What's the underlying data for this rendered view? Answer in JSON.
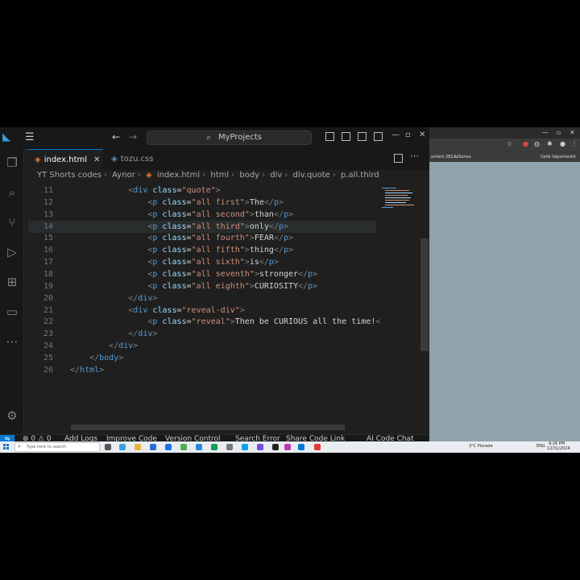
{
  "window": {
    "command_center": "MyProjects"
  },
  "tabs": [
    {
      "label": "index.html",
      "active": true
    },
    {
      "label": "tozu.css",
      "active": false
    }
  ],
  "breadcrumbs": [
    "YT Shorts codes",
    "Aynor",
    "index.html",
    "html",
    "body",
    "div",
    "div.quote",
    "p.all.third"
  ],
  "editor": {
    "lines": [
      {
        "n": "11",
        "indent": 6,
        "tokens": [
          [
            "tg",
            "<"
          ],
          [
            "tn",
            "div"
          ],
          [
            "tx",
            " "
          ],
          [
            "at",
            "class"
          ],
          [
            "tx",
            "="
          ],
          [
            "sv",
            "\"quote\""
          ],
          [
            "tg",
            ">"
          ]
        ]
      },
      {
        "n": "12",
        "indent": 8,
        "tokens": [
          [
            "tg",
            "<"
          ],
          [
            "tn",
            "p"
          ],
          [
            "tx",
            " "
          ],
          [
            "at",
            "class"
          ],
          [
            "tx",
            "="
          ],
          [
            "sv",
            "\"all first\""
          ],
          [
            "tg",
            ">"
          ],
          [
            "tx",
            "The"
          ],
          [
            "tg",
            "</"
          ],
          [
            "tn",
            "p"
          ],
          [
            "tg",
            ">"
          ]
        ]
      },
      {
        "n": "13",
        "indent": 8,
        "tokens": [
          [
            "tg",
            "<"
          ],
          [
            "tn",
            "p"
          ],
          [
            "tx",
            " "
          ],
          [
            "at",
            "class"
          ],
          [
            "tx",
            "="
          ],
          [
            "sv",
            "\"all second\""
          ],
          [
            "tg",
            ">"
          ],
          [
            "tx",
            "than"
          ],
          [
            "tg",
            "</"
          ],
          [
            "tn",
            "p"
          ],
          [
            "tg",
            ">"
          ]
        ]
      },
      {
        "n": "14",
        "indent": 8,
        "tokens": [
          [
            "tg",
            "<"
          ],
          [
            "tn",
            "p"
          ],
          [
            "tx",
            " "
          ],
          [
            "at",
            "class"
          ],
          [
            "tx",
            "="
          ],
          [
            "sv",
            "\"all third\""
          ],
          [
            "tg",
            ">"
          ],
          [
            "tx",
            "only"
          ],
          [
            "tg",
            "</"
          ],
          [
            "tn",
            "p"
          ],
          [
            "tg",
            ">"
          ]
        ],
        "highlight": true
      },
      {
        "n": "15",
        "indent": 8,
        "tokens": [
          [
            "tg",
            "<"
          ],
          [
            "tn",
            "p"
          ],
          [
            "tx",
            " "
          ],
          [
            "at",
            "class"
          ],
          [
            "tx",
            "="
          ],
          [
            "sv",
            "\"all fourth\""
          ],
          [
            "tg",
            ">"
          ],
          [
            "tx",
            "FEAR"
          ],
          [
            "tg",
            "</"
          ],
          [
            "tn",
            "p"
          ],
          [
            "tg",
            ">"
          ]
        ]
      },
      {
        "n": "16",
        "indent": 8,
        "tokens": [
          [
            "tg",
            "<"
          ],
          [
            "tn",
            "p"
          ],
          [
            "tx",
            " "
          ],
          [
            "at",
            "class"
          ],
          [
            "tx",
            "="
          ],
          [
            "sv",
            "\"all fifth\""
          ],
          [
            "tg",
            ">"
          ],
          [
            "tx",
            "thing"
          ],
          [
            "tg",
            "</"
          ],
          [
            "tn",
            "p"
          ],
          [
            "tg",
            ">"
          ]
        ]
      },
      {
        "n": "17",
        "indent": 8,
        "tokens": [
          [
            "tg",
            "<"
          ],
          [
            "tn",
            "p"
          ],
          [
            "tx",
            " "
          ],
          [
            "at",
            "class"
          ],
          [
            "tx",
            "="
          ],
          [
            "sv",
            "\"all sixth\""
          ],
          [
            "tg",
            ">"
          ],
          [
            "tx",
            "is"
          ],
          [
            "tg",
            "</"
          ],
          [
            "tn",
            "p"
          ],
          [
            "tg",
            ">"
          ]
        ]
      },
      {
        "n": "18",
        "indent": 8,
        "tokens": [
          [
            "tg",
            "<"
          ],
          [
            "tn",
            "p"
          ],
          [
            "tx",
            " "
          ],
          [
            "at",
            "class"
          ],
          [
            "tx",
            "="
          ],
          [
            "sv",
            "\"all seventh\""
          ],
          [
            "tg",
            ">"
          ],
          [
            "tx",
            "stronger"
          ],
          [
            "tg",
            "</"
          ],
          [
            "tn",
            "p"
          ],
          [
            "tg",
            ">"
          ]
        ]
      },
      {
        "n": "19",
        "indent": 8,
        "tokens": [
          [
            "tg",
            "<"
          ],
          [
            "tn",
            "p"
          ],
          [
            "tx",
            " "
          ],
          [
            "at",
            "class"
          ],
          [
            "tx",
            "="
          ],
          [
            "sv",
            "\"all eighth\""
          ],
          [
            "tg",
            ">"
          ],
          [
            "tx",
            "CURIOSITY"
          ],
          [
            "tg",
            "</"
          ],
          [
            "tn",
            "p"
          ],
          [
            "tg",
            ">"
          ]
        ]
      },
      {
        "n": "20",
        "indent": 6,
        "tokens": [
          [
            "tg",
            "</"
          ],
          [
            "tn",
            "div"
          ],
          [
            "tg",
            ">"
          ]
        ]
      },
      {
        "n": "21",
        "indent": 6,
        "tokens": [
          [
            "tg",
            "<"
          ],
          [
            "tn",
            "div"
          ],
          [
            "tx",
            " "
          ],
          [
            "at",
            "class"
          ],
          [
            "tx",
            "="
          ],
          [
            "sv",
            "\"reveal-div\""
          ],
          [
            "tg",
            ">"
          ]
        ]
      },
      {
        "n": "22",
        "indent": 8,
        "tokens": [
          [
            "tg",
            "<"
          ],
          [
            "tn",
            "p"
          ],
          [
            "tx",
            " "
          ],
          [
            "at",
            "class"
          ],
          [
            "tx",
            "="
          ],
          [
            "sv",
            "\"reveal\""
          ],
          [
            "tg",
            ">"
          ],
          [
            "tx",
            "Then be CURIOUS all the time!"
          ],
          [
            "tg",
            "<"
          ]
        ]
      },
      {
        "n": "23",
        "indent": 6,
        "tokens": [
          [
            "tg",
            "</"
          ],
          [
            "tn",
            "div"
          ],
          [
            "tg",
            ">"
          ]
        ]
      },
      {
        "n": "24",
        "indent": 4,
        "tokens": [
          [
            "tg",
            "</"
          ],
          [
            "tn",
            "div"
          ],
          [
            "tg",
            ">"
          ]
        ]
      },
      {
        "n": "25",
        "indent": 2,
        "tokens": [
          [
            "tg",
            "</"
          ],
          [
            "tn",
            "body"
          ],
          [
            "tg",
            ">"
          ]
        ]
      },
      {
        "n": "26",
        "indent": 0,
        "tokens": [
          [
            "tg",
            "</"
          ],
          [
            "tn",
            "html"
          ],
          [
            "tg",
            ">"
          ]
        ]
      }
    ]
  },
  "status_bar": {
    "problems": "⊗ 0 ⚠ 0",
    "items": [
      "Add Logs",
      "Improve Code",
      "Version Control",
      "Search Error",
      "Share Code Link",
      "AI Code Chat"
    ]
  },
  "browser": {
    "bookmarks": [
      "ontent 282...",
      "AdSense",
      "Gelik İdipsimerkit"
    ]
  },
  "taskbar": {
    "search_placeholder": "Type here to search",
    "weather": "3°C Plorada",
    "time": "9:26 PM",
    "date": "12/31/2024",
    "lang": "ENG"
  },
  "colors": {
    "accent": "#0078d4",
    "editor_bg": "#1f1f1f",
    "tag": "#569cd6",
    "attribute": "#9cdcfe",
    "string": "#ce9178"
  }
}
